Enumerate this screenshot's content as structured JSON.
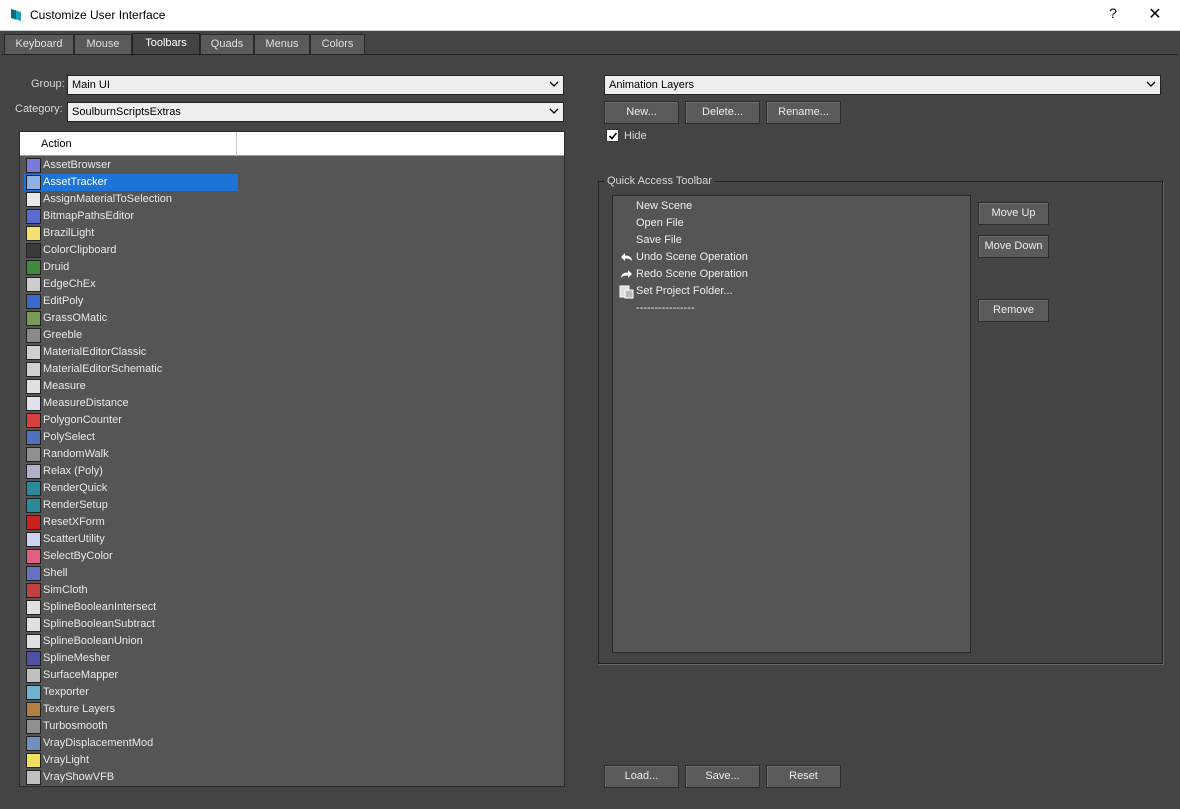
{
  "window": {
    "title": "Customize User Interface",
    "help": "?",
    "close": "✕"
  },
  "tabs": [
    "Keyboard",
    "Mouse",
    "Toolbars",
    "Quads",
    "Menus",
    "Colors"
  ],
  "active_tab": "Toolbars",
  "left": {
    "group_label": "Group:",
    "group_value": "Main UI",
    "category_label": "Category:",
    "category_value": "SoulburnScriptsExtras",
    "list_header": "Action",
    "selected": "AssetTracker",
    "actions": [
      "AssetBrowser",
      "AssetTracker",
      "AssignMaterialToSelection",
      "BitmapPathsEditor",
      "BrazilLight",
      "ColorClipboard",
      "Druid",
      "EdgeChEx",
      "EditPoly",
      "GrassOMatic",
      "Greeble",
      "MaterialEditorClassic",
      "MaterialEditorSchematic",
      "Measure",
      "MeasureDistance",
      "PolygonCounter",
      "PolySelect",
      "RandomWalk",
      "Relax (Poly)",
      "RenderQuick",
      "RenderSetup",
      "ResetXForm",
      "ScatterUtility",
      "SelectByColor",
      "Shell",
      "SimCloth",
      "SplineBooleanIntersect",
      "SplineBooleanSubtract",
      "SplineBooleanUnion",
      "SplineMesher",
      "SurfaceMapper",
      "Texporter",
      "Texture Layers",
      "Turbosmooth",
      "VrayDisplacementMod",
      "VrayLight",
      "VrayShowVFB"
    ],
    "icon_colors": [
      "#7a7ad8",
      "#8fb0e0",
      "#e8e8e8",
      "#5a6ad0",
      "#f4e070",
      "#3a3a3a",
      "#3f8a3f",
      "#cccccc",
      "#3a6ad0",
      "#7a9a5a",
      "#8a8a8a",
      "#d0d0d0",
      "#d0d0d0",
      "#e0e0e0",
      "#e0e0f0",
      "#d84040",
      "#5070c0",
      "#909090",
      "#b0b0c8",
      "#2a8a9a",
      "#2a8a9a",
      "#cc2020",
      "#d0d0f0",
      "#e06080",
      "#6a70c0",
      "#c04040",
      "#e0e0e0",
      "#e0e0e0",
      "#e0e0e0",
      "#5050a0",
      "#c0c0c0",
      "#70b0d0",
      "#b08040",
      "#909090",
      "#7090c0",
      "#f0e060",
      "#c0c0c0"
    ]
  },
  "right": {
    "toolbar_value": "Animation Layers",
    "new_button": "New...",
    "delete_button": "Delete...",
    "rename_button": "Rename...",
    "hide_label": "Hide",
    "hide_checked": true,
    "group_title": "Quick Access Toolbar",
    "items": [
      {
        "label": "New Scene",
        "icon": ""
      },
      {
        "label": "Open File",
        "icon": ""
      },
      {
        "label": "Save File",
        "icon": ""
      },
      {
        "label": "Undo Scene Operation",
        "icon": "undo-icon"
      },
      {
        "label": "Redo Scene Operation",
        "icon": "redo-icon"
      },
      {
        "label": "Set Project Folder...",
        "icon": "folder-icon"
      },
      {
        "label": "----------------",
        "icon": ""
      }
    ],
    "move_up": "Move Up",
    "move_down": "Move Down",
    "remove": "Remove"
  },
  "footer": {
    "load": "Load...",
    "save": "Save...",
    "reset": "Reset"
  },
  "colors": {
    "selection": "#1e73d7",
    "background": "#444444",
    "app_icon": "#1aa3b8"
  }
}
